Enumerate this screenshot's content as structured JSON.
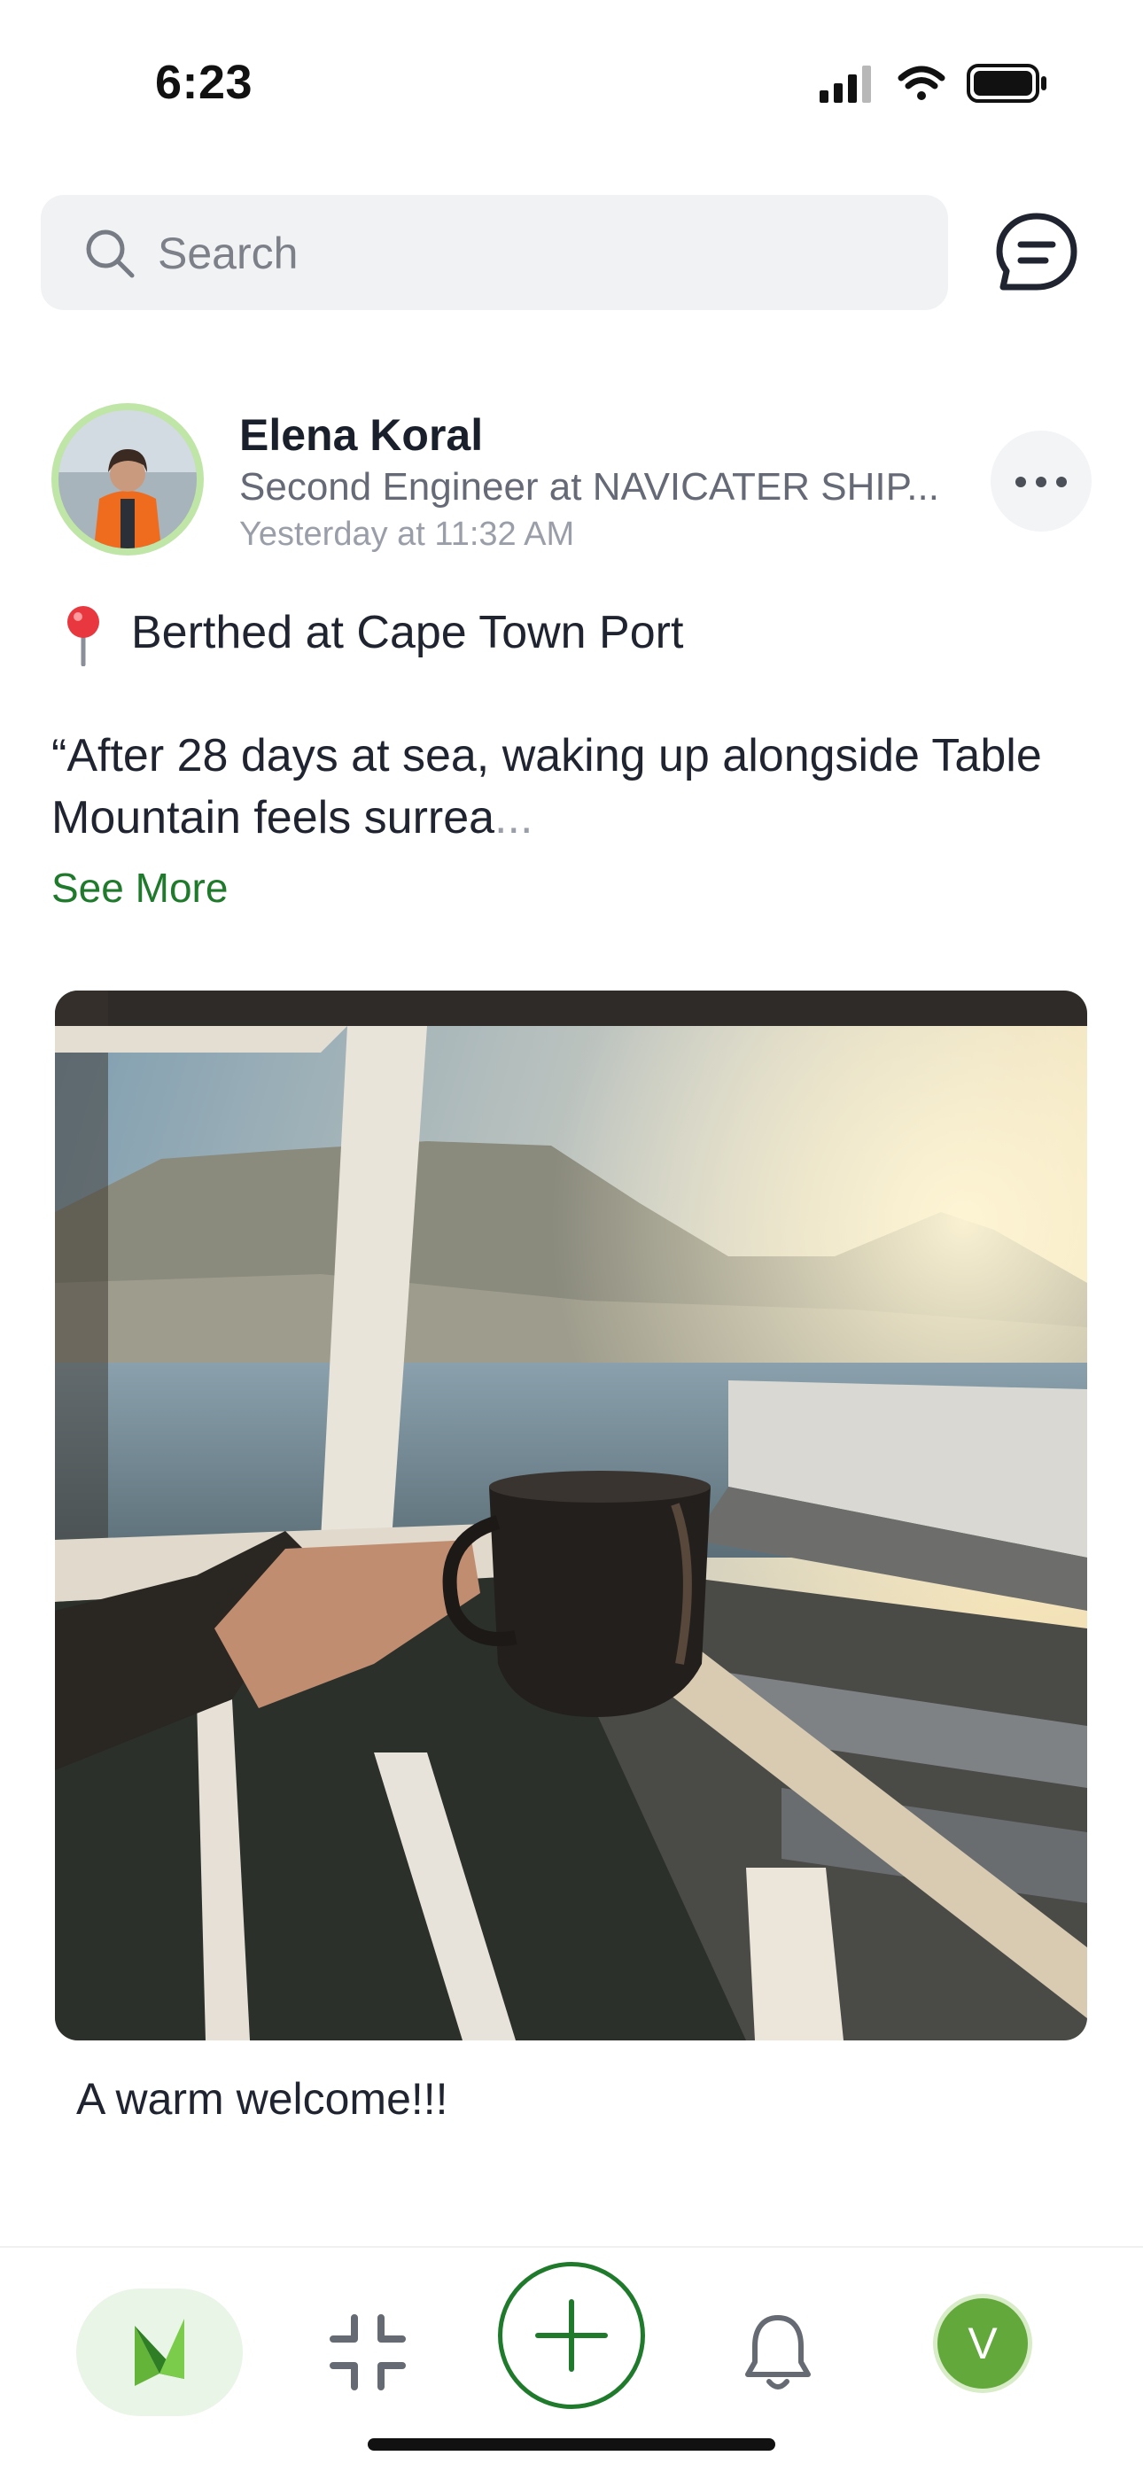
{
  "status_bar": {
    "time": "6:23"
  },
  "search": {
    "placeholder": "Search"
  },
  "post": {
    "author": "Elena Koral",
    "role": "Second Engineer at NAVICATER SHIP...",
    "timestamp": "Yesterday at 11:32 AM",
    "location": "Berthed at Cape Town Port",
    "body_text": "“After 28 days at sea, waking up alongside Table Mountain feels surrea",
    "body_ellipsis": "...",
    "see_more": "See More",
    "caption": "A warm welcome!!!"
  },
  "nav": {
    "profile_initial": "V"
  },
  "colors": {
    "accent_green": "#1f7a2c",
    "profile_green": "#62a83b",
    "search_bg": "#f1f2f4"
  }
}
